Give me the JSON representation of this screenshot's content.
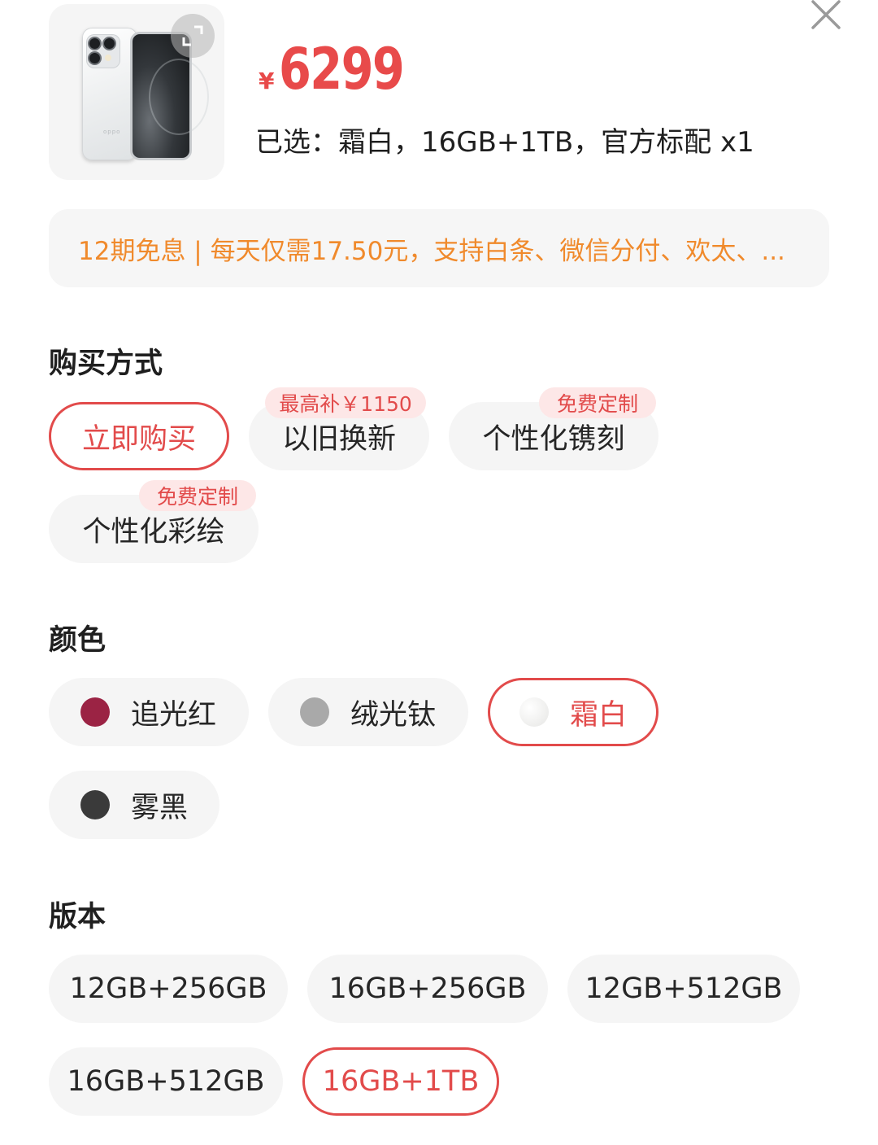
{
  "product": {
    "price_symbol": "¥",
    "price": "6299",
    "selected_label": "已选：霜白，16GB+1TB，官方标配 x1"
  },
  "installment": {
    "text": "12期免息 | 每天仅需17.50元，支持白条、微信分付、欢太、..."
  },
  "purchase": {
    "title": "购买方式",
    "options": [
      {
        "label": "立即购买",
        "tag": "",
        "selected": true
      },
      {
        "label": "以旧换新",
        "tag": "最高补￥1150",
        "selected": false
      },
      {
        "label": "个性化镌刻",
        "tag": "免费定制",
        "selected": false
      },
      {
        "label": "个性化彩绘",
        "tag": "免费定制",
        "selected": false
      }
    ]
  },
  "color": {
    "title": "颜色",
    "options": [
      {
        "label": "追光红",
        "swatch": "#9b2344",
        "selected": false
      },
      {
        "label": "绒光钛",
        "swatch": "#a9a9a9",
        "selected": false
      },
      {
        "label": "霜白",
        "swatch": "#f1f1f0",
        "selected": true
      },
      {
        "label": "雾黑",
        "swatch": "#3a3a3a",
        "selected": false
      }
    ]
  },
  "version": {
    "title": "版本",
    "options": [
      {
        "label": "12GB+256GB",
        "selected": false
      },
      {
        "label": "16GB+256GB",
        "selected": false
      },
      {
        "label": "12GB+512GB",
        "selected": false
      },
      {
        "label": "16GB+512GB",
        "selected": false
      },
      {
        "label": "16GB+1TB",
        "selected": true
      }
    ]
  },
  "icons": {
    "close": "close-icon",
    "expand": "expand-icon"
  },
  "colors": {
    "accent": "#e24b4b",
    "installment_text": "#f08a2c",
    "chip_bg": "#f5f5f5",
    "tag_bg": "#fde7e7"
  }
}
